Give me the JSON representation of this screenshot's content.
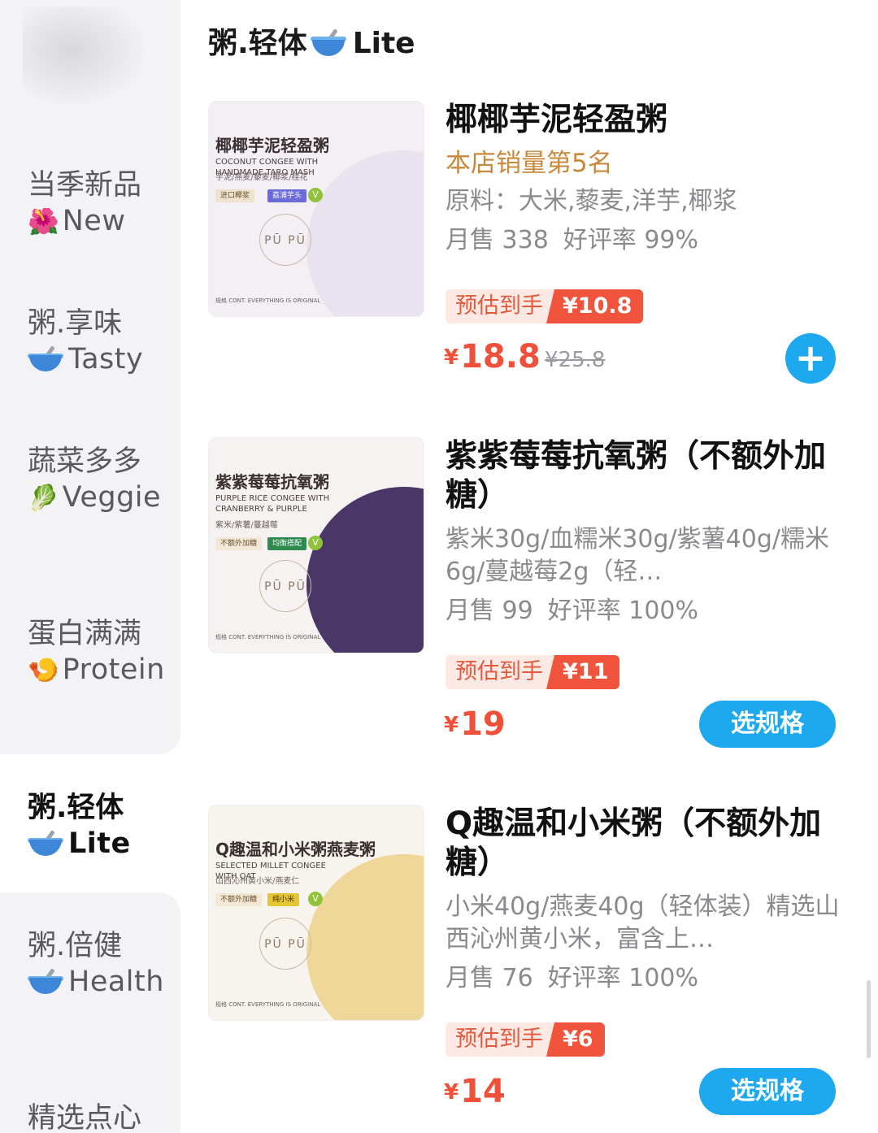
{
  "sidebar": {
    "items": [
      {
        "label_cn": "当季新品",
        "icon": "hibiscus-icon",
        "icon_glyph": "🌺",
        "label_en": "New",
        "active": false
      },
      {
        "label_cn": "粥.享味",
        "icon": "bowl-spoon-icon",
        "label_en": "Tasty",
        "active": false
      },
      {
        "label_cn": "蔬菜多多",
        "icon": "leafy-green-icon",
        "icon_glyph": "🥬",
        "label_en": "Veggie",
        "active": false
      },
      {
        "label_cn": "蛋白满满",
        "icon": "shrimp-icon",
        "icon_glyph": "🍤",
        "label_en": "Protein",
        "active": false
      },
      {
        "label_cn": "粥.轻体",
        "icon": "bowl-spoon-icon",
        "label_en": "Lite",
        "active": true
      },
      {
        "label_cn": "粥.倍健",
        "icon": "bowl-spoon-icon",
        "label_en": "Health",
        "active": false
      },
      {
        "label_cn": "精选点心",
        "icon": "",
        "label_en": "",
        "active": false
      }
    ]
  },
  "section": {
    "title_cn": "粥.轻体",
    "icon": "bowl-spoon-icon",
    "title_en": "Lite"
  },
  "products": [
    {
      "name": "椰椰芋泥轻盈粥",
      "rank": "本店销量第5名",
      "desc": "原料：大米,藜麦,洋芋,椰浆",
      "monthly_sales": "月售 338",
      "rating": "好评率 99%",
      "est_label": "预估到手",
      "est_price": "¥10.8",
      "currency": "¥",
      "price": "18.8",
      "orig_price": "¥25.8",
      "action": "plus",
      "thumb": {
        "title": "椰椰芋泥轻盈粥",
        "en": "COCONUT CONGEE WITH HANDMADE TARO MASH",
        "ing": "芋泥/燕麦/藜麦/椰浆/桂花",
        "tag1": "进口椰浆",
        "tag2": "荔浦芋头",
        "stamp": "PŪ PŪ",
        "foot": "规格 CONT.   EVERYTHING IS ORIGINAL",
        "bg": "#f4eef5",
        "bowl": "#e9e3ef",
        "tag2_color": "#6a6ad8"
      }
    },
    {
      "name": "紫紫莓莓抗氧粥（不额外加糖）",
      "desc": "紫米30g/血糯米30g/紫薯40g/糯米6g/蔓越莓2g（轻…",
      "monthly_sales": "月售 99",
      "rating": "好评率 100%",
      "est_label": "预估到手",
      "est_price": "¥11",
      "currency": "¥",
      "price": "19",
      "action_label": "选规格",
      "action": "spec",
      "thumb": {
        "title": "紫紫莓莓抗氧粥",
        "en": "PURPLE RICE CONGEE WITH CRANBERRY & PURPLE",
        "ing": "紫米/紫薯/蔓越莓",
        "tag1": "不额外加糖",
        "tag2": "均衡搭配",
        "stamp": "PŪ PŪ",
        "foot": "规格 CONT.   EVERYTHING IS ORIGINAL",
        "bg": "#f6f2f1",
        "bowl": "#4a3768",
        "tag2_color": "#2f8a52"
      }
    },
    {
      "name": "Q趣温和小米粥（不额外加糖）",
      "desc": "小米40g/燕麦40g（轻体装）精选山西沁州黄小米，富含上…",
      "monthly_sales": "月售 76",
      "rating": "好评率 100%",
      "est_label": "预估到手",
      "est_price": "¥6",
      "currency": "¥",
      "price": "14",
      "action_label": "选规格",
      "action": "spec",
      "thumb": {
        "title": "Q趣温和小米粥燕麦粥",
        "en": "SELECTED MILLET CONGEE WITH OAT",
        "ing": "山西沁州黄小米/燕麦仁",
        "tag1": "不额外加糖",
        "tag2": "纯小米",
        "stamp": "PŪ PŪ",
        "foot": "规格 CONT.   EVERYTHING IS ORIGINAL",
        "bg": "#f7f4ee",
        "bowl": "#efd79a",
        "tag2_color": "#e6c532"
      }
    }
  ]
}
